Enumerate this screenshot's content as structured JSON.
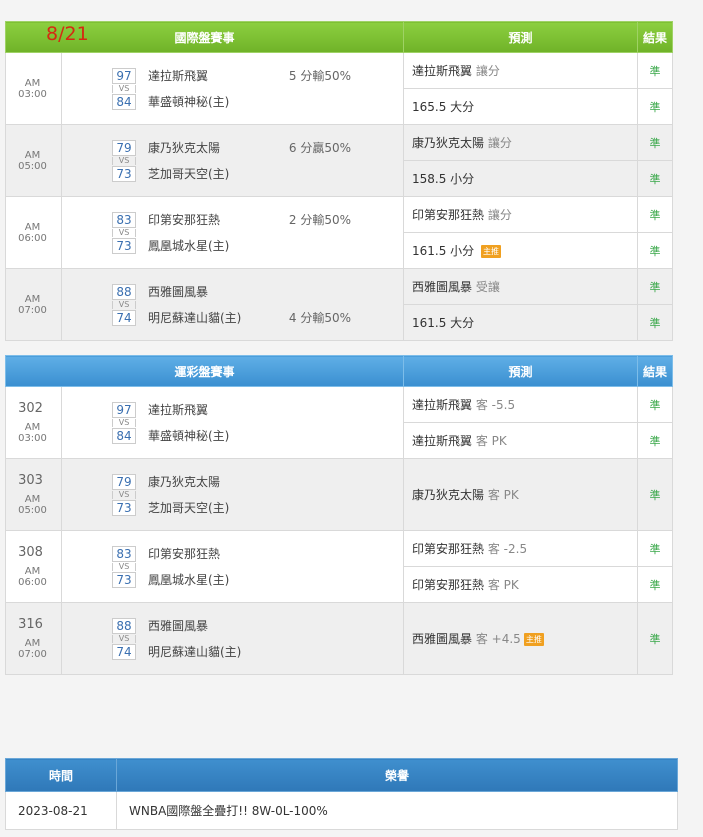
{
  "international": {
    "date": "8/21",
    "title": "國際盤賽事",
    "pred_header": "預測",
    "result_header": "結果",
    "games": [
      {
        "time": "AM 03:00",
        "away_score": "97",
        "away": "達拉斯飛翼",
        "home_score": "84",
        "home": "華盛頓神秘(主)",
        "result_text": "5 分輸50%",
        "result_row": 1,
        "preds": [
          {
            "main": "達拉斯飛翼",
            "sub": "讓分",
            "badge": "",
            "result": "準"
          },
          {
            "main": "165.5 大分",
            "sub": "",
            "badge": "",
            "result": "準"
          }
        ]
      },
      {
        "time": "AM 05:00",
        "away_score": "79",
        "away": "康乃狄克太陽",
        "home_score": "73",
        "home": "芝加哥天空(主)",
        "result_text": "6 分贏50%",
        "result_row": 1,
        "preds": [
          {
            "main": "康乃狄克太陽",
            "sub": "讓分",
            "badge": "",
            "result": "準"
          },
          {
            "main": "158.5 小分",
            "sub": "",
            "badge": "",
            "result": "準"
          }
        ]
      },
      {
        "time": "AM 06:00",
        "away_score": "83",
        "away": "印第安那狂熱",
        "home_score": "73",
        "home": "鳳凰城水星(主)",
        "result_text": "2 分輸50%",
        "result_row": 1,
        "preds": [
          {
            "main": "印第安那狂熱",
            "sub": "讓分",
            "badge": "",
            "result": "準"
          },
          {
            "main": "161.5 小分",
            "sub": "",
            "badge": "主推",
            "result": "準"
          }
        ]
      },
      {
        "time": "AM 07:00",
        "away_score": "88",
        "away": "西雅圖風暴",
        "home_score": "74",
        "home": "明尼蘇達山貓(主)",
        "result_text": "4 分輸50%",
        "result_row": 2,
        "preds": [
          {
            "main": "西雅圖風暴",
            "sub": "受讓",
            "badge": "",
            "result": "準"
          },
          {
            "main": "161.5 大分",
            "sub": "",
            "badge": "",
            "result": "準"
          }
        ]
      }
    ]
  },
  "sports_lottery": {
    "title": "運彩盤賽事",
    "pred_header": "預測",
    "result_header": "結果",
    "games": [
      {
        "num": "302",
        "time": "AM 03:00",
        "away_score": "97",
        "away": "達拉斯飛翼",
        "home_score": "84",
        "home": "華盛頓神秘(主)",
        "preds": [
          {
            "main": "達拉斯飛翼",
            "sub": "客 -5.5",
            "badge": "",
            "result": "準"
          },
          {
            "main": "達拉斯飛翼",
            "sub": "客 PK",
            "badge": "",
            "result": "準"
          }
        ]
      },
      {
        "num": "303",
        "time": "AM 05:00",
        "away_score": "79",
        "away": "康乃狄克太陽",
        "home_score": "73",
        "home": "芝加哥天空(主)",
        "preds": [
          {
            "main": "康乃狄克太陽",
            "sub": "客 PK",
            "badge": "",
            "result": "準"
          }
        ]
      },
      {
        "num": "308",
        "time": "AM 06:00",
        "away_score": "83",
        "away": "印第安那狂熱",
        "home_score": "73",
        "home": "鳳凰城水星(主)",
        "preds": [
          {
            "main": "印第安那狂熱",
            "sub": "客 -2.5",
            "badge": "",
            "result": "準"
          },
          {
            "main": "印第安那狂熱",
            "sub": "客 PK",
            "badge": "",
            "result": "準"
          }
        ]
      },
      {
        "num": "316",
        "time": "AM 07:00",
        "away_score": "88",
        "away": "西雅圖風暴",
        "home_score": "74",
        "home": "明尼蘇達山貓(主)",
        "preds": [
          {
            "main": "西雅圖風暴",
            "sub": "客 +4.5",
            "badge": "主推",
            "result": "準"
          }
        ]
      }
    ]
  },
  "honor": {
    "time_header": "時間",
    "honor_header": "榮譽",
    "rows": [
      {
        "date": "2023-08-21",
        "text": "WNBA國際盤全疊打!! 8W-0L-100%"
      }
    ]
  }
}
